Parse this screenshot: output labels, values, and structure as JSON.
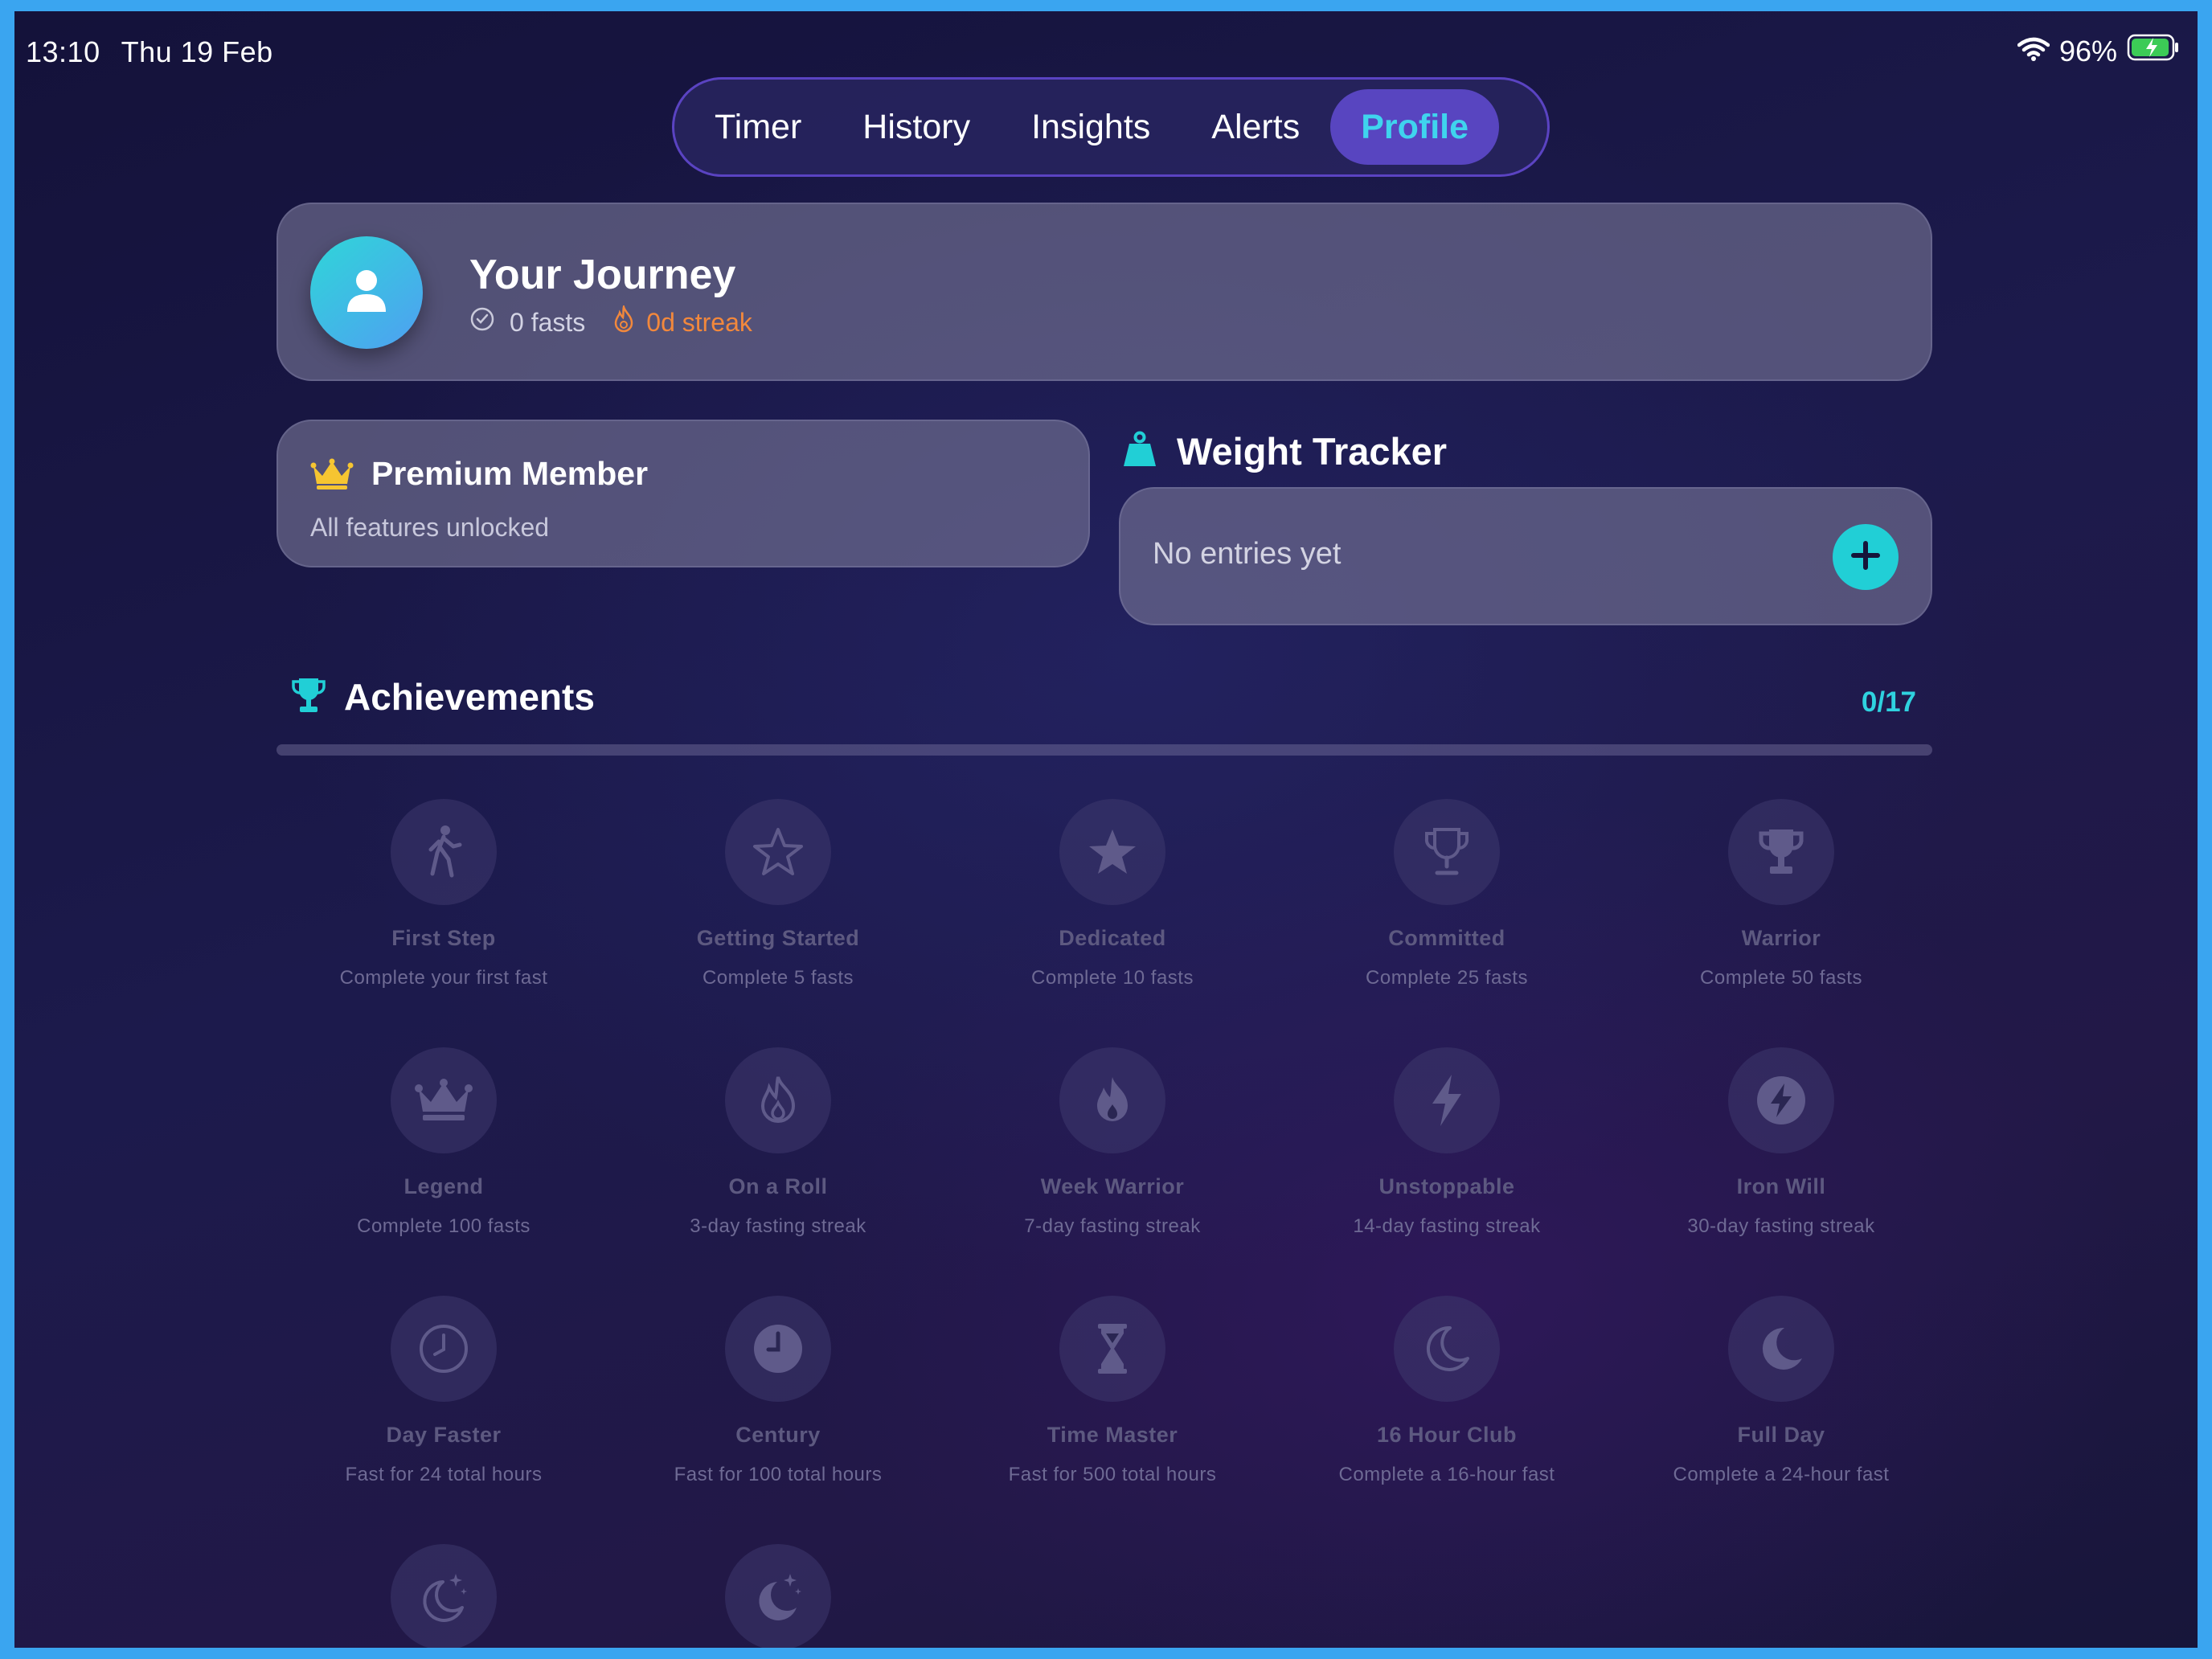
{
  "status_bar": {
    "time": "13:10",
    "date": "Thu 19 Feb",
    "battery_percent": "96%",
    "battery_level": 0.96
  },
  "tabs": [
    {
      "label": "Timer",
      "active": false
    },
    {
      "label": "History",
      "active": false
    },
    {
      "label": "Insights",
      "active": false
    },
    {
      "label": "Alerts",
      "active": false
    },
    {
      "label": "Profile",
      "active": true
    }
  ],
  "journey": {
    "title": "Your Journey",
    "fasts": "0 fasts",
    "streak": "0d streak",
    "icons": [
      "person-icon",
      "check-circle-icon",
      "flame-icon"
    ]
  },
  "premium": {
    "title": "Premium Member",
    "subtitle": "All features unlocked",
    "icon": "crown-icon"
  },
  "weight_tracker": {
    "title": "Weight Tracker",
    "empty_text": "No entries yet",
    "icon": "scale-weight-icon",
    "add_icon": "plus-icon"
  },
  "achievements": {
    "title": "Achievements",
    "count": "0/17",
    "progress": 0,
    "items": [
      {
        "name": "First Step",
        "desc": "Complete your first fast",
        "icon": "walking-icon"
      },
      {
        "name": "Getting Started",
        "desc": "Complete 5 fasts",
        "icon": "star-outline-icon"
      },
      {
        "name": "Dedicated",
        "desc": "Complete 10 fasts",
        "icon": "star-icon"
      },
      {
        "name": "Committed",
        "desc": "Complete 25 fasts",
        "icon": "trophy-outline-icon"
      },
      {
        "name": "Warrior",
        "desc": "Complete 50 fasts",
        "icon": "trophy-icon"
      },
      {
        "name": "Legend",
        "desc": "Complete 100 fasts",
        "icon": "crown-icon"
      },
      {
        "name": "On a Roll",
        "desc": "3-day fasting streak",
        "icon": "flame-outline-icon"
      },
      {
        "name": "Week Warrior",
        "desc": "7-day fasting streak",
        "icon": "flame-icon"
      },
      {
        "name": "Unstoppable",
        "desc": "14-day fasting streak",
        "icon": "bolt-icon"
      },
      {
        "name": "Iron Will",
        "desc": "30-day fasting streak",
        "icon": "bolt-circle-icon"
      },
      {
        "name": "Day Faster",
        "desc": "Fast for 24 total hours",
        "icon": "clock-outline-icon"
      },
      {
        "name": "Century",
        "desc": "Fast for 100 total hours",
        "icon": "clock-icon"
      },
      {
        "name": "Time Master",
        "desc": "Fast for 500 total hours",
        "icon": "hourglass-icon"
      },
      {
        "name": "16 Hour Club",
        "desc": "Complete a 16-hour fast",
        "icon": "moon-outline-icon"
      },
      {
        "name": "Full Day",
        "desc": "Complete a 24-hour fast",
        "icon": "moon-icon"
      },
      {
        "name": "",
        "desc": "",
        "icon": "moon-stars-outline-icon"
      },
      {
        "name": "",
        "desc": "",
        "icon": "moon-stars-icon"
      }
    ]
  },
  "colors": {
    "accent_cyan": "#2fd2df",
    "streak_orange": "#f2883c",
    "crown_gold": "#f6c531",
    "tab_active_bg": "#624bd2"
  }
}
